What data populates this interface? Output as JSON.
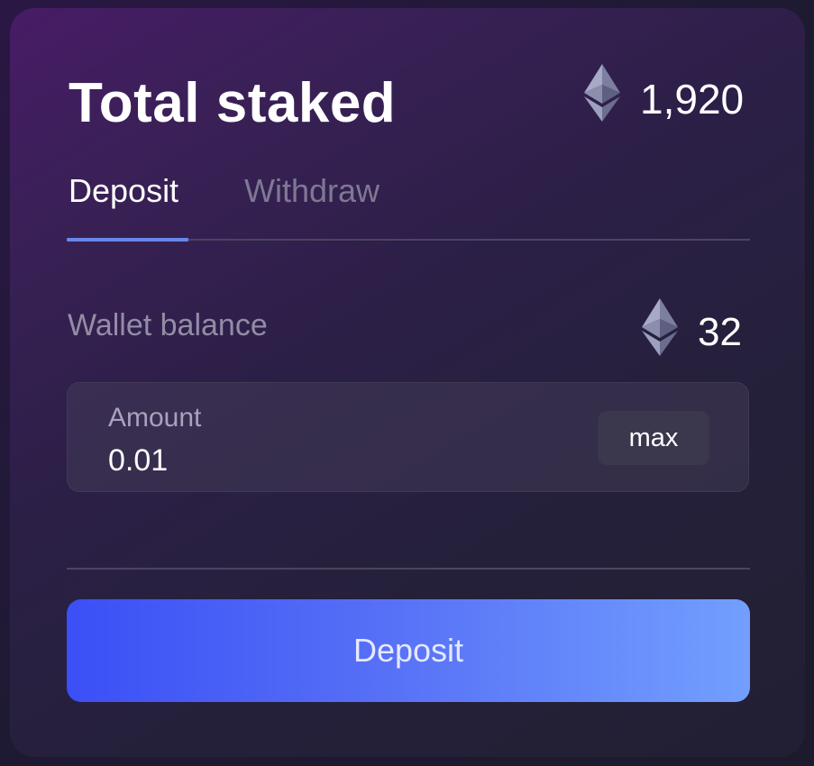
{
  "header": {
    "title": "Total staked",
    "total_value": "1,920",
    "token_icon": "ethereum-icon"
  },
  "tabs": [
    {
      "label": "Deposit",
      "active": true
    },
    {
      "label": "Withdraw",
      "active": false
    }
  ],
  "wallet": {
    "label": "Wallet balance",
    "value": "32",
    "token_icon": "ethereum-icon"
  },
  "amount": {
    "label": "Amount",
    "value": "0.01",
    "max_label": "max"
  },
  "actions": {
    "deposit_label": "Deposit"
  },
  "colors": {
    "accent": "#6a86e8",
    "button_start": "#3b4ff6",
    "button_end": "#729ffe"
  }
}
